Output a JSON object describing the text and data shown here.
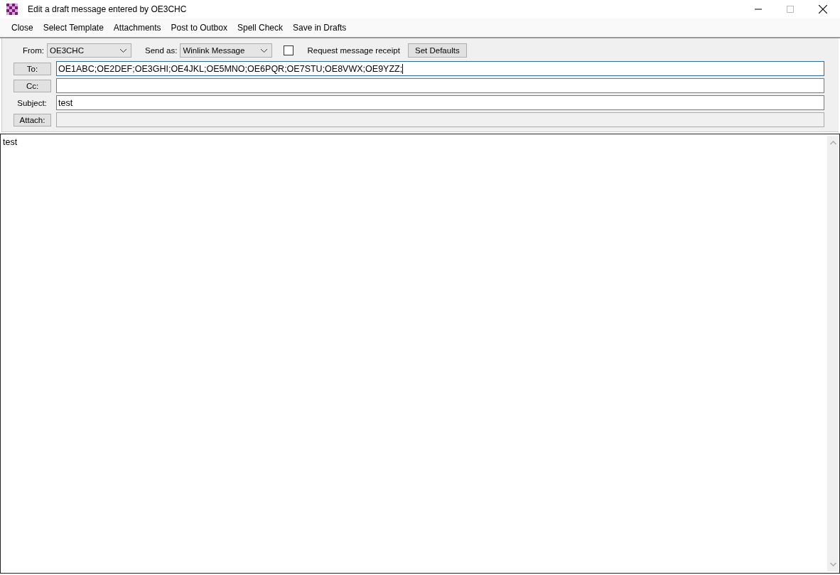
{
  "window": {
    "title": "Edit a draft message entered by OE3CHC"
  },
  "menu": [
    "Close",
    "Select Template",
    "Attachments",
    "Post to Outbox",
    "Spell Check",
    "Save in Drafts"
  ],
  "from": {
    "label": "From:",
    "value": "OE3CHC"
  },
  "send_as": {
    "label": "Send as:",
    "value": "Winlink Message"
  },
  "receipt": {
    "label": "Request message receipt",
    "checked": false
  },
  "set_defaults": "Set Defaults",
  "fields": [
    {
      "kind": "button",
      "label": "To:",
      "value": "OE1ABC;OE2DEF;OE3GHI;OE4JKL;OE5MNO;OE6PQR;OE7STU;OE8VWX;OE9YZZ;",
      "focused": true,
      "disabled": false
    },
    {
      "kind": "button",
      "label": "Cc:",
      "focused": false,
      "disabled": false
    },
    {
      "kind": "text",
      "label": "Subject:",
      "value": "test",
      "focused": false,
      "disabled": false
    },
    {
      "kind": "button",
      "label": "Attach:",
      "focused": false,
      "disabled": true
    }
  ],
  "body": {
    "value": "test"
  }
}
